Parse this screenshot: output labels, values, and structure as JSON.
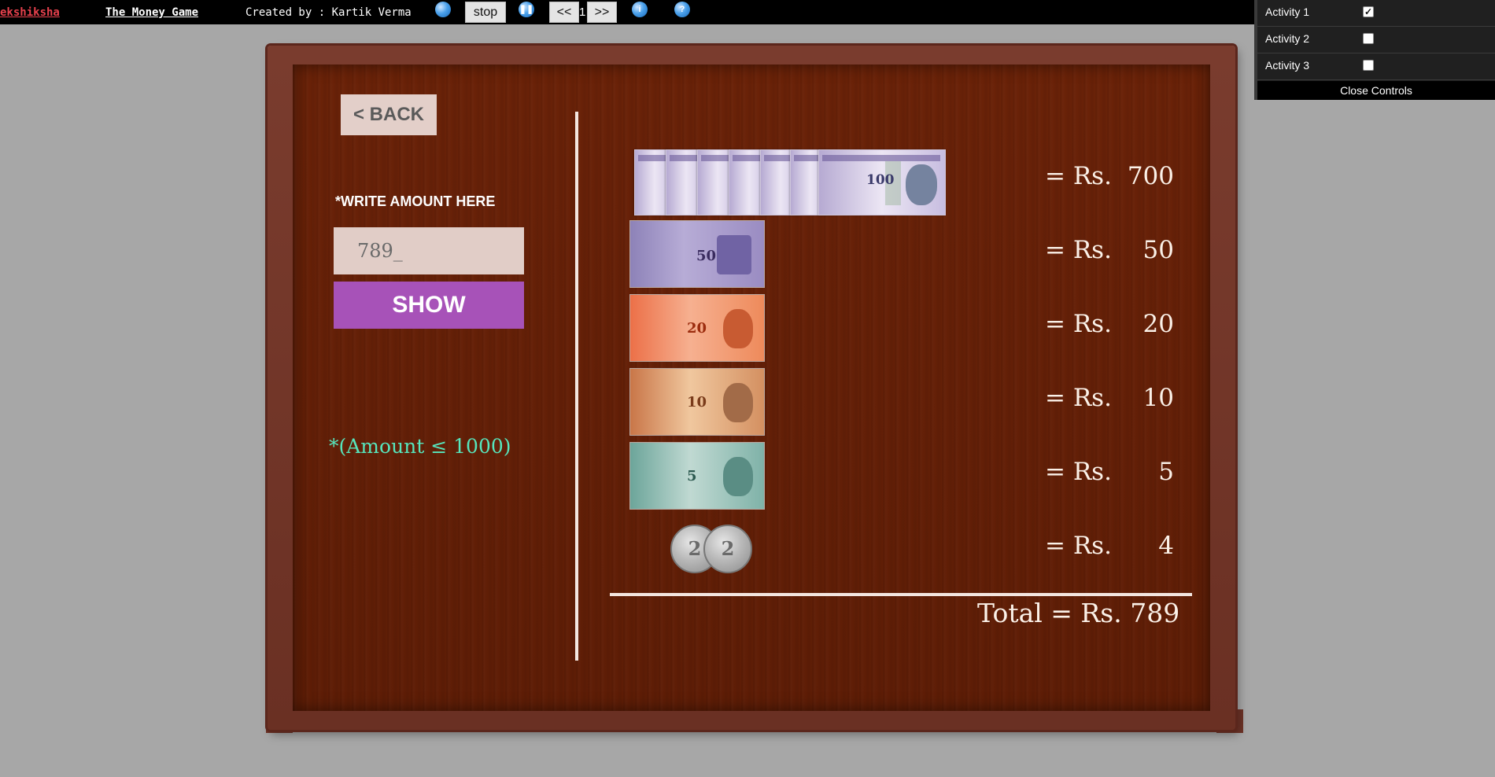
{
  "topbar": {
    "brand": "ekshiksha",
    "title": "The Money Game",
    "credit": "Created by : Kartik Verma",
    "stop_label": "stop",
    "prev_label": "<<",
    "page_number": "1",
    "next_label": ">>",
    "info_symbol": "i",
    "help_symbol": "?"
  },
  "controls": {
    "activities": [
      {
        "label": "Activity 1",
        "checked": true
      },
      {
        "label": "Activity 2",
        "checked": false
      },
      {
        "label": "Activity 3",
        "checked": false
      }
    ],
    "close_label": "Close Controls"
  },
  "game": {
    "back_label": "< BACK",
    "write_label": "*WRITE AMOUNT HERE",
    "input_value": "789_",
    "show_label": "SHOW",
    "limit_note": "*(Amount ≤ 1000)",
    "breakdown": [
      {
        "prefix": "= Rs.",
        "value": "700",
        "note": "100",
        "count": 7
      },
      {
        "prefix": "= Rs.",
        "value": "50",
        "note": "50",
        "count": 1
      },
      {
        "prefix": "= Rs.",
        "value": "20",
        "note": "20",
        "count": 1
      },
      {
        "prefix": "= Rs.",
        "value": "10",
        "note": "10",
        "count": 1
      },
      {
        "prefix": "= Rs.",
        "value": "5",
        "note": "5",
        "count": 1
      },
      {
        "prefix": "= Rs.",
        "value": "4",
        "coin": "2",
        "count": 2
      }
    ],
    "total_prefix": "Total = Rs.",
    "total_value": "789"
  },
  "colors": {
    "board": "#5e1d06",
    "frame": "#6a3023",
    "show_button": "#a752b8",
    "limit_note": "#56e6bd",
    "brand": "#e8414d"
  }
}
